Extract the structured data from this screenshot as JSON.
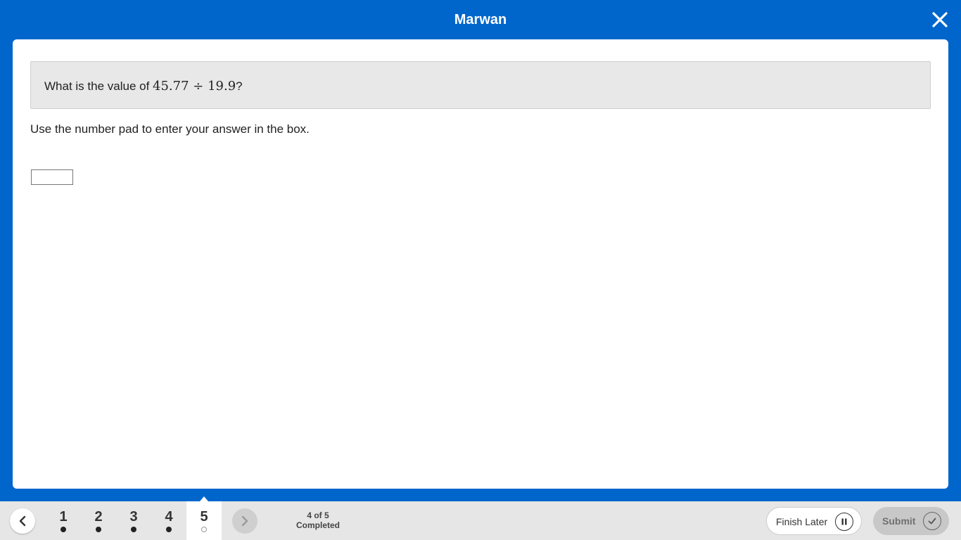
{
  "header": {
    "title": "Marwan",
    "close_icon": "close-icon"
  },
  "question": {
    "prefix": "What is the value of ",
    "expression": "45.77 ÷ 19.9",
    "suffix": "?",
    "instruction": "Use the number pad to enter your answer in the box.",
    "answer_value": "",
    "answer_placeholder": ""
  },
  "footer": {
    "prev_icon": "chevron-left-icon",
    "next_icon": "chevron-right-icon",
    "tabs": [
      {
        "label": "1",
        "status": "completed"
      },
      {
        "label": "2",
        "status": "completed"
      },
      {
        "label": "3",
        "status": "completed"
      },
      {
        "label": "4",
        "status": "completed"
      },
      {
        "label": "5",
        "status": "incomplete",
        "active": true
      }
    ],
    "progress_line1": "4 of 5",
    "progress_line2": "Completed",
    "finish_later_label": "Finish Later",
    "finish_later_icon": "pause-icon",
    "submit_label": "Submit",
    "submit_icon": "check-icon"
  },
  "colors": {
    "brand_blue": "#0066cc",
    "card_bg": "#ffffff",
    "footer_bg": "#e6e6e6"
  }
}
